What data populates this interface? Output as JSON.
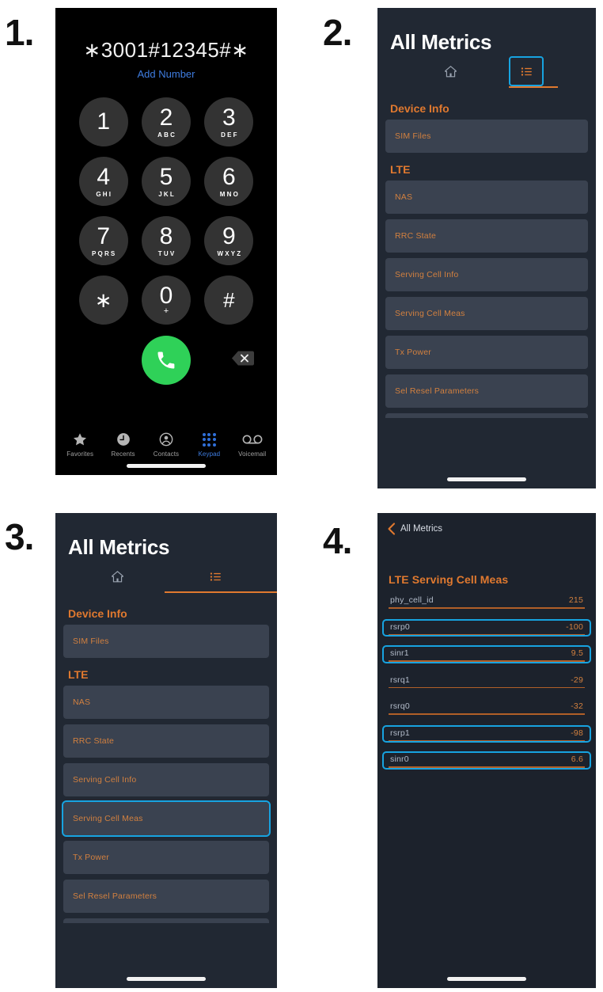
{
  "steps": {
    "one": "1.",
    "two": "2.",
    "three": "3.",
    "four": "4."
  },
  "colors": {
    "accent_orange": "#e0792f",
    "row_orange": "#d2803f",
    "highlight_cyan": "#17a3e0",
    "ios_blue": "#3f7de0",
    "call_green": "#2fd158",
    "panel_bg": "#212833",
    "row_bg": "#3a4250"
  },
  "dialer": {
    "number": "∗3001#12345#∗",
    "add_number_label": "Add Number",
    "keys": [
      {
        "digit": "1",
        "letters": ""
      },
      {
        "digit": "2",
        "letters": "ABC"
      },
      {
        "digit": "3",
        "letters": "DEF"
      },
      {
        "digit": "4",
        "letters": "GHI"
      },
      {
        "digit": "5",
        "letters": "JKL"
      },
      {
        "digit": "6",
        "letters": "MNO"
      },
      {
        "digit": "7",
        "letters": "PQRS"
      },
      {
        "digit": "8",
        "letters": "TUV"
      },
      {
        "digit": "9",
        "letters": "WXYZ"
      },
      {
        "digit": "∗",
        "letters": ""
      },
      {
        "digit": "0",
        "letters": "+"
      },
      {
        "digit": "#",
        "letters": ""
      }
    ],
    "call_icon": "phone-icon",
    "backspace_icon": "backspace-icon",
    "tabs": [
      {
        "label": "Favorites",
        "icon": "star-icon",
        "active": false
      },
      {
        "label": "Recents",
        "icon": "clock-icon",
        "active": false
      },
      {
        "label": "Contacts",
        "icon": "person-circle-icon",
        "active": false
      },
      {
        "label": "Keypad",
        "icon": "keypad-dots-icon",
        "active": true
      },
      {
        "label": "Voicemail",
        "icon": "voicemail-icon",
        "active": false
      }
    ]
  },
  "metrics": {
    "title": "All Metrics",
    "tabs": [
      {
        "icon": "home-icon",
        "name": "home-tab",
        "selected": false
      },
      {
        "icon": "list-icon",
        "name": "list-tab",
        "selected": true
      }
    ],
    "sections": [
      {
        "header": "Device Info",
        "items": [
          {
            "label": "SIM Files"
          }
        ]
      },
      {
        "header": "LTE",
        "items": [
          {
            "label": "NAS"
          },
          {
            "label": "RRC State"
          },
          {
            "label": "Serving Cell Info"
          },
          {
            "label": "Serving Cell Meas"
          },
          {
            "label": "Tx Power"
          },
          {
            "label": "Sel Resel Parameters"
          }
        ]
      }
    ],
    "panel2_highlight": "list-tab",
    "panel3_highlight": "Serving Cell Meas"
  },
  "detail": {
    "back_label": "All Metrics",
    "back_icon": "chevron-left-icon",
    "title": "LTE Serving Cell Meas",
    "rows": [
      {
        "label": "phy_cell_id",
        "value": "215",
        "highlighted": false
      },
      {
        "label": "rsrp0",
        "value": "-100",
        "highlighted": true
      },
      {
        "label": "sinr1",
        "value": "9.5",
        "highlighted": true
      },
      {
        "label": "rsrq1",
        "value": "-29",
        "highlighted": false
      },
      {
        "label": "rsrq0",
        "value": "-32",
        "highlighted": false
      },
      {
        "label": "rsrp1",
        "value": "-98",
        "highlighted": true
      },
      {
        "label": "sinr0",
        "value": "6.6",
        "highlighted": true
      }
    ]
  }
}
